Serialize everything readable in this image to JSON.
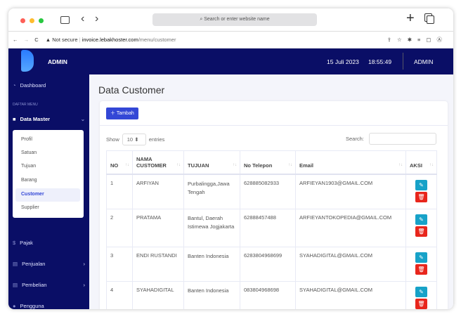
{
  "browser": {
    "address_placeholder": "Search or enter website name",
    "security": "Not secure",
    "url_host": "invoice.lebakhoster.com",
    "url_path": "/menu/customer"
  },
  "header": {
    "brand": "ADMIN",
    "date": "15 Juli 2023",
    "time": "18:55:49",
    "user": "ADMIN"
  },
  "sidebar": {
    "dashboard": "Dashboard",
    "section": "DAFTAR MENU",
    "data_master": "Data Master",
    "sub": [
      "Profil",
      "Satuan",
      "Tujuan",
      "Barang",
      "Customer",
      "Supplier"
    ],
    "items": [
      "Pajak",
      "Penjualan",
      "Pembelian",
      "Pengguna"
    ]
  },
  "page": {
    "title": "Data Customer",
    "add_label": "Tambah",
    "show": "Show",
    "entries_value": "10",
    "entries": "entries",
    "search": "Search:"
  },
  "table": {
    "headers": [
      "NO",
      "NAMA CUSTOMER",
      "TUJUAN",
      "No Telepon",
      "Email",
      "AKSI"
    ],
    "rows": [
      [
        "1",
        "ARFIYAN",
        "Purbalingga,Jawa Tengah",
        "628885082933",
        "ARFIEYAN1903@GMAIL.COM"
      ],
      [
        "2",
        "PRATAMA",
        "Bantul, Daerah Istimewa Jogjakarta",
        "62888457488",
        "ARFIEYANTOKOPEDIA@GMAIL.COM"
      ],
      [
        "3",
        "ENDI RUSTANDI",
        "Banten Indonesia",
        "6283804968699",
        "SYAHADIGITAL@GMAIL.COM"
      ],
      [
        "4",
        "SYAHADIGITAL",
        "Banten Indonesia",
        "083804968698",
        "SYAHADIGITAL@GMAIL.COM"
      ]
    ]
  },
  "colors": {
    "navy": "#0a0e66",
    "primary": "#3347d6",
    "info": "#17a2c8",
    "danger": "#e8261c"
  }
}
